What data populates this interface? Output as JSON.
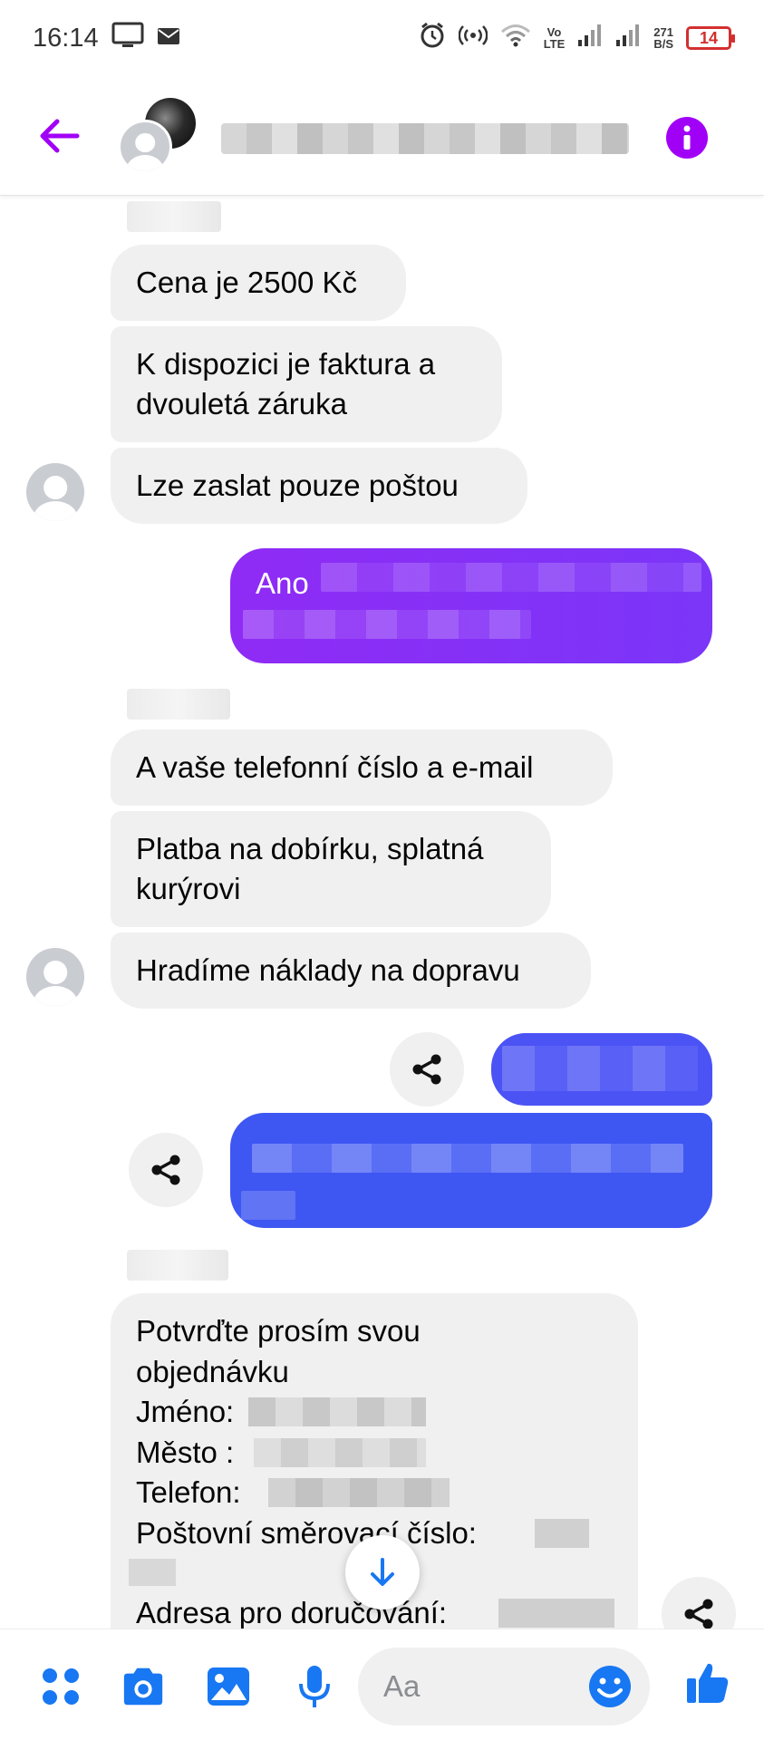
{
  "status_bar": {
    "time": "16:14",
    "volte_top": "Vo",
    "volte_bottom": "LTE",
    "speed_top": "271",
    "speed_bottom": "B/S",
    "battery": "14"
  },
  "header": {
    "contact_name": ""
  },
  "messages": [
    {
      "id": "m1",
      "side": "in",
      "text": "Cena je 2500 Kč"
    },
    {
      "id": "m2",
      "side": "in",
      "text": "K dispozici je faktura a dvouletá záruka"
    },
    {
      "id": "m3",
      "side": "in",
      "text": "Lze zaslat pouze poštou"
    },
    {
      "id": "m4",
      "side": "out",
      "text": "Ano"
    },
    {
      "id": "m5",
      "side": "in",
      "text": "A vaše telefonní číslo a e-mail"
    },
    {
      "id": "m6",
      "side": "in",
      "text": "Platba na dobírku, splatná kurýrovi"
    },
    {
      "id": "m7",
      "side": "in",
      "text": "Hradíme náklady na dopravu"
    },
    {
      "id": "m8",
      "side": "out",
      "text": ""
    },
    {
      "id": "m9",
      "side": "out",
      "text": ""
    },
    {
      "id": "m10",
      "side": "in",
      "text_lines": [
        "Potvrďte prosím svou",
        "objednávku",
        "Jméno:",
        "Město :",
        "Telefon:",
        "Poštovní směrovací číslo:",
        "",
        "Adresa pro doručování:"
      ]
    }
  ],
  "composer": {
    "placeholder": "Aa"
  },
  "colors": {
    "accent_purple": "#a100f7",
    "bubble_out_purple": "#8f2bf5",
    "bubble_out_blue": "#3e56f2",
    "bubble_in": "#f0f0f0",
    "composer_icons": "#1877f2"
  },
  "icons": [
    "back-arrow-icon",
    "info-icon",
    "share-icon",
    "arrow-down-icon",
    "menu-dots-icon",
    "camera-icon",
    "image-icon",
    "microphone-icon",
    "emoji-icon",
    "like-icon"
  ]
}
